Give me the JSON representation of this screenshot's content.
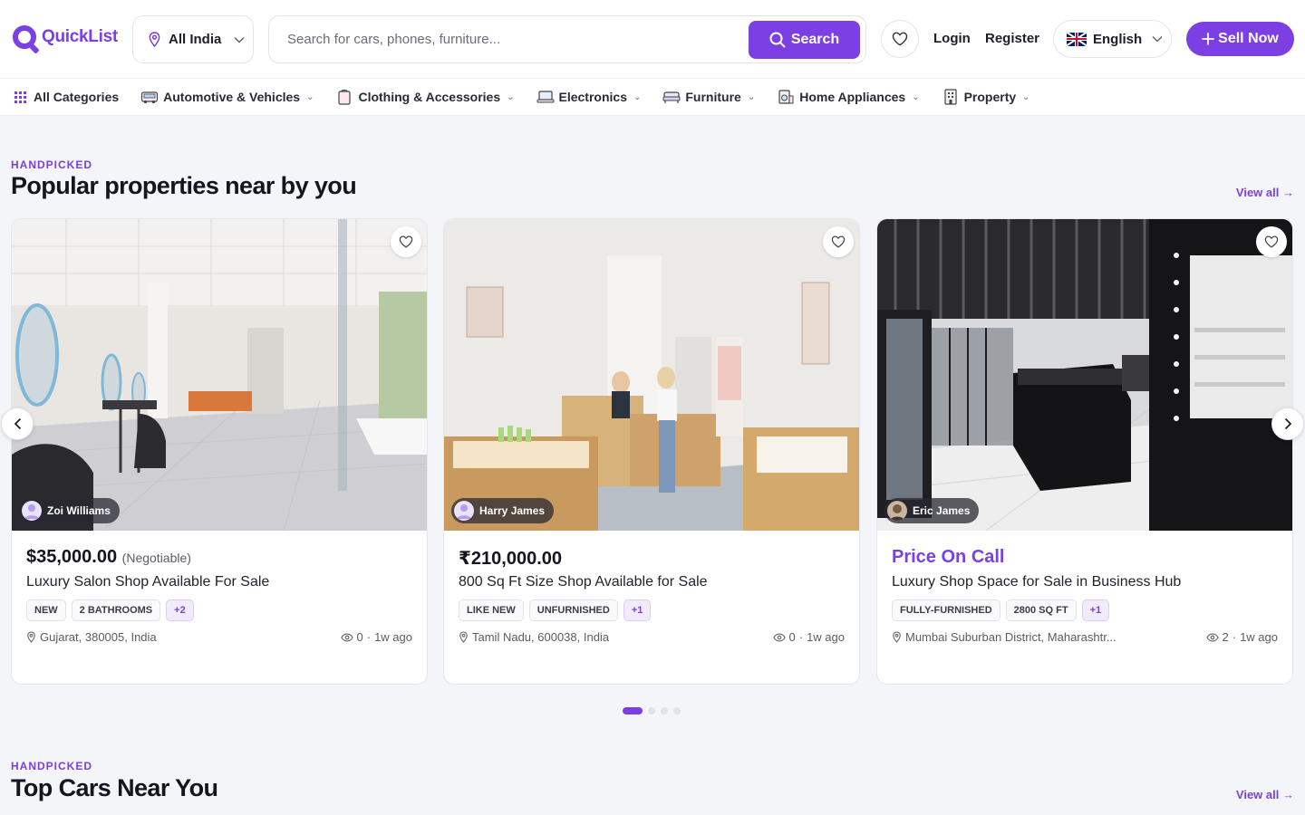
{
  "header": {
    "logo_text": "QuickList",
    "location": "All India",
    "search_placeholder": "Search for cars, phones, furniture...",
    "search_button": "Search",
    "login": "Login",
    "register": "Register",
    "language": "English",
    "sell_button": "Sell Now"
  },
  "categories": [
    {
      "label": "All Categories",
      "icon": "grid-icon"
    },
    {
      "label": "Automotive & Vehicles",
      "icon": "car-icon"
    },
    {
      "label": "Clothing & Accessories",
      "icon": "shirt-icon"
    },
    {
      "label": "Electronics",
      "icon": "laptop-icon"
    },
    {
      "label": "Furniture",
      "icon": "sofa-icon"
    },
    {
      "label": "Home Appliances",
      "icon": "appliance-icon"
    },
    {
      "label": "Property",
      "icon": "building-icon"
    }
  ],
  "section1": {
    "eyebrow": "HANDPICKED",
    "title": "Popular properties near by you",
    "view_all": "View all"
  },
  "section2": {
    "eyebrow": "HANDPICKED",
    "title": "Top Cars Near You",
    "view_all": "View all"
  },
  "listings": [
    {
      "seller": "Zoi Williams",
      "price": "$35,000.00",
      "price_note": "(Negotiable)",
      "title": "Luxury Salon Shop Available For Sale",
      "tags": [
        "NEW",
        "2 BATHROOMS"
      ],
      "more": "+2",
      "location": "Gujarat, 380005, India",
      "views": "0",
      "age": "1w ago"
    },
    {
      "seller": "Harry James",
      "price": "₹210,000.00",
      "price_note": "",
      "title": "800 Sq Ft Size Shop Available for Sale",
      "tags": [
        "LIKE NEW",
        "UNFURNISHED"
      ],
      "more": "+1",
      "location": "Tamil Nadu, 600038, India",
      "views": "0",
      "age": "1w ago"
    },
    {
      "seller": "Eric James",
      "price": "Price On Call",
      "price_note": "",
      "title": "Luxury Shop Space for Sale in Business Hub",
      "tags": [
        "FULLY-FURNISHED",
        "2800 SQ FT"
      ],
      "more": "+1",
      "location": "Mumbai Suburban District, Maharashtr...",
      "views": "2",
      "age": "1w ago"
    }
  ],
  "carousel": {
    "pages": 4,
    "active": 0
  },
  "colors": {
    "accent": "#7b3fe4",
    "background": "#f4f5f8"
  }
}
